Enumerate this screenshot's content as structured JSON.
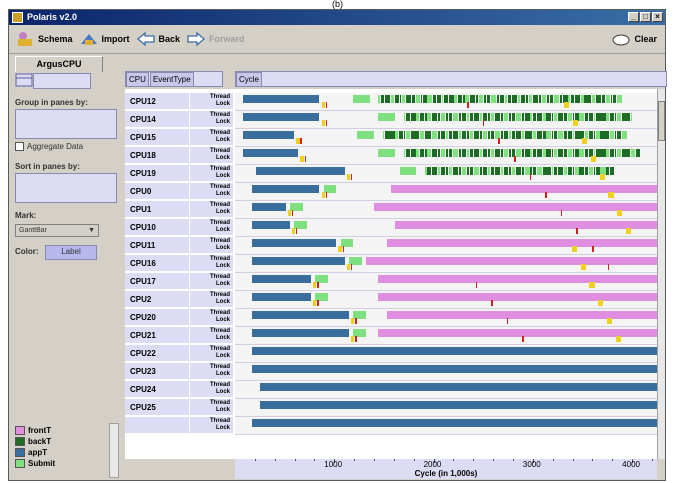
{
  "caption": "(b)",
  "window": {
    "title": "Polaris v2.0",
    "controls": [
      "_",
      "□",
      "×"
    ]
  },
  "toolbar": {
    "schema": "Schema",
    "import": "Import",
    "back": "Back",
    "forward": "Forward",
    "clear": "Clear"
  },
  "tab": "ArgusCPU",
  "left": {
    "group_label": "Group in panes by:",
    "aggregate_label": "Aggregate Data",
    "sort_label": "Sort in panes by:",
    "mark_label": "Mark:",
    "mark_value": "GanttBar",
    "color_label": "Color:",
    "color_value": "Label"
  },
  "shelves": {
    "rows": [
      "CPU",
      "EventType"
    ],
    "columns": [
      "Cycle"
    ]
  },
  "event_types": [
    "Thread",
    "Lock"
  ],
  "rows": [
    {
      "cpu": "CPU12",
      "blue": [
        0.02,
        0.2
      ],
      "dense": [
        0.34,
        0.92
      ],
      "end": 0.98
    },
    {
      "cpu": "CPU14",
      "blue": [
        0.02,
        0.2
      ],
      "dense": [
        0.4,
        0.94
      ],
      "end": 0.98
    },
    {
      "cpu": "CPU15",
      "blue": [
        0.02,
        0.14
      ],
      "dense": [
        0.35,
        0.93
      ],
      "end": 0.98
    },
    {
      "cpu": "CPU18",
      "blue": [
        0.02,
        0.15
      ],
      "dense": [
        0.4,
        0.96
      ],
      "end": 0.98
    },
    {
      "cpu": "CPU19",
      "blue": [
        0.05,
        0.26
      ],
      "dense": [
        0.45,
        0.9
      ],
      "end": 0.98
    },
    {
      "cpu": "CPU0",
      "blue": [
        0.04,
        0.2
      ],
      "pink": [
        0.37,
        1.0
      ]
    },
    {
      "cpu": "CPU1",
      "blue": [
        0.04,
        0.12
      ],
      "pink": [
        0.33,
        1.0
      ]
    },
    {
      "cpu": "CPU10",
      "blue": [
        0.04,
        0.13
      ],
      "pink": [
        0.38,
        1.0
      ]
    },
    {
      "cpu": "CPU11",
      "blue": [
        0.04,
        0.24
      ],
      "pink": [
        0.36,
        1.0
      ]
    },
    {
      "cpu": "CPU16",
      "blue": [
        0.04,
        0.26
      ],
      "pink": [
        0.31,
        1.0
      ]
    },
    {
      "cpu": "CPU17",
      "blue": [
        0.04,
        0.18
      ],
      "pink": [
        0.34,
        1.0
      ]
    },
    {
      "cpu": "CPU2",
      "blue": [
        0.04,
        0.18
      ],
      "pink": [
        0.34,
        1.0
      ]
    },
    {
      "cpu": "CPU20",
      "blue": [
        0.04,
        0.27
      ],
      "pink": [
        0.36,
        1.0
      ]
    },
    {
      "cpu": "CPU21",
      "blue": [
        0.04,
        0.27
      ],
      "pink": [
        0.34,
        1.0
      ]
    },
    {
      "cpu": "CPU22",
      "blue": [
        0.04,
        1.0
      ]
    },
    {
      "cpu": "CPU23",
      "blue": [
        0.04,
        1.0
      ]
    },
    {
      "cpu": "CPU24",
      "blue": [
        0.06,
        1.0
      ]
    },
    {
      "cpu": "CPU25",
      "blue": [
        0.06,
        1.0
      ]
    },
    {
      "cpu": "",
      "blue": [
        0.04,
        1.0
      ]
    }
  ],
  "axis": {
    "ticks": [
      "1000",
      "2000",
      "3000",
      "4000"
    ],
    "title": "Cycle (in 1,000s)"
  },
  "legend": [
    {
      "label": "frontT",
      "color": "#e08ee0"
    },
    {
      "label": "backT",
      "color": "#1e6b26"
    },
    {
      "label": "appT",
      "color": "#3a6e9c"
    },
    {
      "label": "Submit",
      "color": "#7ee07e"
    }
  ],
  "colors": {
    "pink": "#e08ee0",
    "blue": "#3a6e9c",
    "dark_green": "#1e6b26",
    "light_green": "#7ee07e",
    "yellow": "#f0d020",
    "red": "#d02020"
  }
}
